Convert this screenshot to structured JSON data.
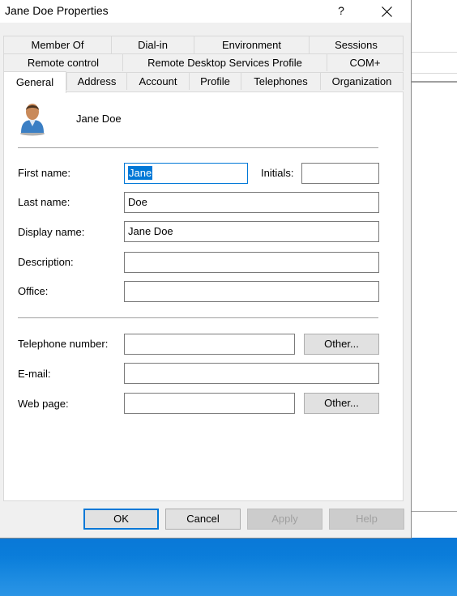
{
  "window": {
    "title": "Jane Doe Properties",
    "help_glyph": "?"
  },
  "tabs": {
    "row1": [
      "Member Of",
      "Dial-in",
      "Environment",
      "Sessions"
    ],
    "row2": [
      "Remote control",
      "Remote Desktop Services Profile",
      "COM+"
    ],
    "row3": [
      "General",
      "Address",
      "Account",
      "Profile",
      "Telephones",
      "Organization"
    ],
    "active": "General"
  },
  "general": {
    "user_name": "Jane Doe",
    "labels": {
      "first_name": "First name:",
      "initials": "Initials:",
      "last_name": "Last name:",
      "display_name": "Display name:",
      "description": "Description:",
      "office": "Office:",
      "telephone": "Telephone number:",
      "email": "E-mail:",
      "web_page": "Web page:"
    },
    "values": {
      "first_name": "Jane",
      "initials": "",
      "last_name": "Doe",
      "display_name": "Jane Doe",
      "description": "",
      "office": "",
      "telephone": "",
      "email": "",
      "web_page": ""
    },
    "other_label": "Other..."
  },
  "footer": {
    "ok": "OK",
    "cancel": "Cancel",
    "apply": "Apply",
    "help": "Help"
  },
  "colors": {
    "accent": "#0078d7",
    "desktop": "#0b7fdb"
  }
}
